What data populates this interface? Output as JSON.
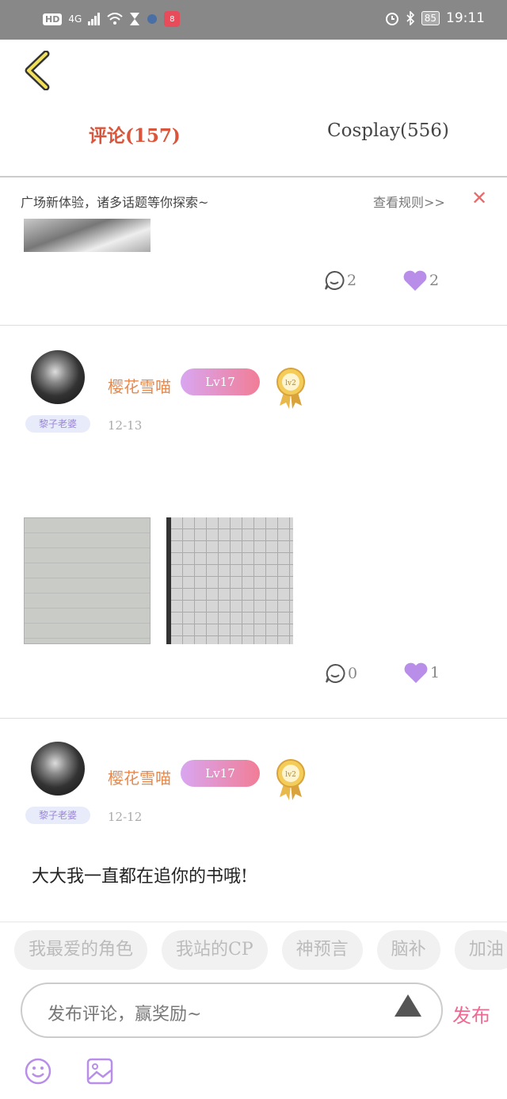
{
  "status_bar": {
    "hd": "HD",
    "network": "4G",
    "app_badge": "8",
    "battery": "85",
    "time": "19:11"
  },
  "tabs": [
    {
      "label": "评论(157)",
      "active": true
    },
    {
      "label": "Cosplay(556)",
      "active": false
    }
  ],
  "notice": {
    "text": "广场新体验，诸多话题等你探索~",
    "rules_link": "查看规则>>"
  },
  "posts": [
    {
      "comments": "2",
      "likes": "2"
    },
    {
      "username": "樱花雪喵",
      "level": "Lv17",
      "medal": "lv2",
      "tag": "黎子老婆",
      "date": "12-13",
      "comments": "0",
      "likes": "1"
    },
    {
      "username": "樱花雪喵",
      "level": "Lv17",
      "medal": "lv2",
      "tag": "黎子老婆",
      "date": "12-12",
      "text": "大大我一直都在追你的书哦!"
    }
  ],
  "topics": [
    "我最爱的角色",
    "我站的CP",
    "神预言",
    "脑补",
    "加油"
  ],
  "composer": {
    "placeholder": "发布评论，赢奖励~",
    "publish": "发布"
  },
  "colors": {
    "accent": "#d9553b",
    "like_purple": "#b88ee8",
    "publish_pink": "#ee6a92",
    "username_orange": "#e6894e"
  }
}
